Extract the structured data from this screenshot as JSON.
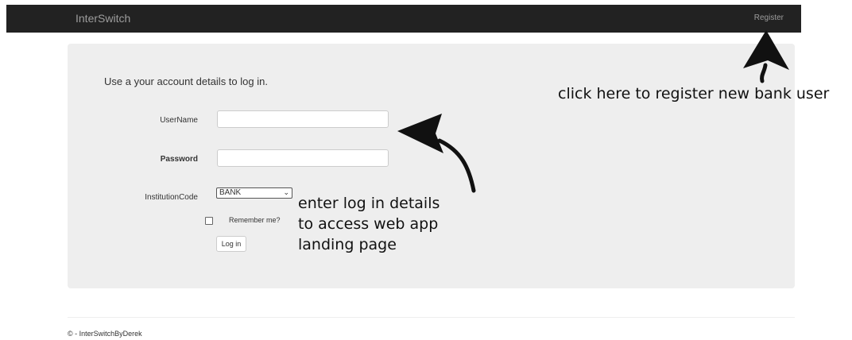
{
  "navbar": {
    "brand": "InterSwitch",
    "register_label": "Register"
  },
  "login": {
    "intro": "Use a your account details to log in.",
    "username_label": "UserName",
    "password_label": "Password",
    "institution_label": "InstitutionCode",
    "institution_selected": "BANK",
    "remember_label": "Remember me?",
    "login_button": "Log in"
  },
  "annotations": {
    "register_hint": "click here to register new bank user",
    "login_hint_line1": "enter log in details",
    "login_hint_line2": "to access web app",
    "login_hint_line3": "landing page"
  },
  "footer": {
    "copyright": "© - InterSwitchByDerek"
  },
  "icons": {
    "dropdown": "chevron-down-icon",
    "annotation_arrows": "curved-arrow-icon"
  }
}
